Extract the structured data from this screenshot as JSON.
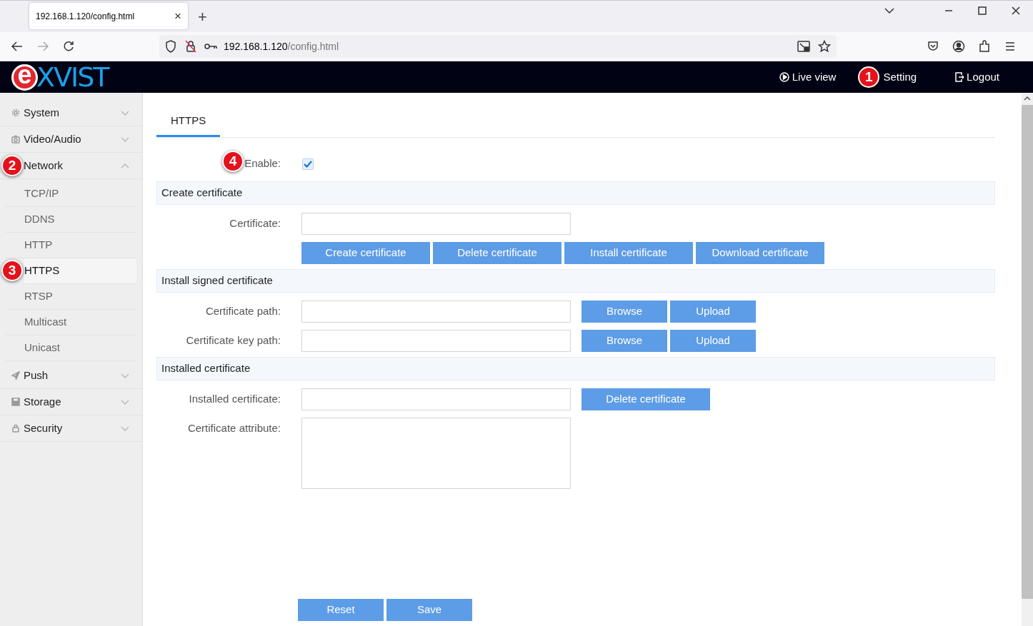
{
  "browser": {
    "tab_title": "192.168.1.120/config.html",
    "tab_close": "×",
    "new_tab": "+",
    "url_host": "192.168.1.120",
    "url_path": "/config.html"
  },
  "header": {
    "logo": {
      "first": "e",
      "rest": "XVIST"
    },
    "nav": [
      {
        "label": "Live view"
      },
      {
        "label": "Setting",
        "callout": "1"
      },
      {
        "label": "Logout"
      }
    ]
  },
  "sidebar": {
    "items": [
      {
        "label": "System",
        "expanded": false
      },
      {
        "label": "Video/Audio",
        "expanded": false
      },
      {
        "label": "Network",
        "callout": "2",
        "expanded": true,
        "children": [
          {
            "label": "TCP/IP",
            "selected": false
          },
          {
            "label": "DDNS",
            "selected": false
          },
          {
            "label": "HTTP",
            "selected": false
          },
          {
            "label": "HTTPS",
            "selected": true,
            "callout": "3"
          },
          {
            "label": "RTSP",
            "selected": false
          },
          {
            "label": "Multicast",
            "selected": false
          },
          {
            "label": "Unicast",
            "selected": false
          }
        ]
      },
      {
        "label": "Push",
        "expanded": false
      },
      {
        "label": "Storage",
        "expanded": false
      },
      {
        "label": "Security",
        "expanded": false
      }
    ]
  },
  "tabs": [
    {
      "label": "HTTPS",
      "selected": true
    }
  ],
  "enable": {
    "label": "Enable:",
    "checked": true,
    "callout": "4"
  },
  "sections": [
    {
      "title": "Create certificate",
      "rows": [
        {
          "kind": "input",
          "label": "Certificate:"
        },
        {
          "kind": "buttons",
          "buttons": [
            "Create certificate",
            "Delete certificate",
            "Install certificate",
            "Download certificate"
          ]
        }
      ]
    },
    {
      "title": "Install signed certificate",
      "rows": [
        {
          "kind": "input",
          "label": "Certificate path:",
          "buttons": [
            "Browse",
            "Upload"
          ]
        },
        {
          "kind": "input",
          "label": "Certificate key path:",
          "buttons": [
            "Browse",
            "Upload"
          ]
        }
      ]
    },
    {
      "title": "Installed certificate",
      "rows": [
        {
          "kind": "input",
          "label": "Installed certificate:",
          "buttons": [
            "Delete certificate"
          ]
        },
        {
          "kind": "textarea",
          "label": "Certificate attribute:"
        }
      ]
    }
  ],
  "actions": [
    "Reset",
    "Save"
  ]
}
